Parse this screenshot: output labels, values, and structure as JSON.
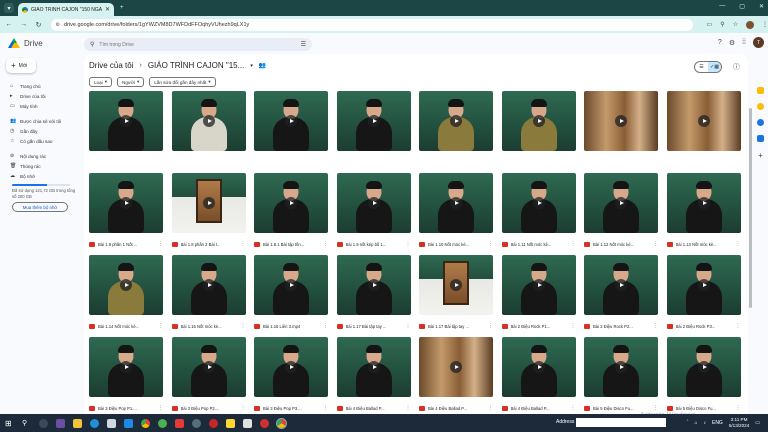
{
  "browser": {
    "tab_title": "GIÁO TRÌNH CAJON \"150 NGÀ",
    "url": "drive.google.com/drive/folders/1gYWZVM8D7WFDdFFOqhyVUhezh9qLX1y"
  },
  "app": {
    "name": "Drive"
  },
  "search": {
    "placeholder": "Tìm trong Drive"
  },
  "user": {
    "initial": "T"
  },
  "new_button": {
    "label": "Mới"
  },
  "sidebar": {
    "items": [
      {
        "label": "Trang chủ",
        "icon": "home-icon"
      },
      {
        "label": "Drive của tôi",
        "icon": "drive-icon"
      },
      {
        "label": "Máy tính",
        "icon": "computer-icon"
      },
      {
        "label": "Được chia sẻ với tôi",
        "icon": "people-icon"
      },
      {
        "label": "Gần đây",
        "icon": "clock-icon"
      },
      {
        "label": "Có gắn dấu sao",
        "icon": "star-icon"
      },
      {
        "label": "Nội dung rác",
        "icon": "spam-icon"
      },
      {
        "label": "Thùng rác",
        "icon": "trash-icon"
      },
      {
        "label": "Bộ nhớ",
        "icon": "cloud-icon"
      }
    ],
    "storage_text": "Đã sử dụng 121,72 GB trong tổng số 200 GB",
    "storage_fraction": 0.61,
    "buy_label": "Mua thêm bộ nhớ"
  },
  "breadcrumb": {
    "root": "Drive của tôi",
    "folder": "GIÁO TRÌNH CAJON \"15..."
  },
  "filters": [
    "Loại",
    "Người",
    "Lần sửa đổi gần đây nhất"
  ],
  "files": [
    {
      "name": "",
      "thumb": "person-dark"
    },
    {
      "name": "",
      "thumb": "person-light"
    },
    {
      "name": "",
      "thumb": "person-dark"
    },
    {
      "name": "",
      "thumb": "person-dark"
    },
    {
      "name": "",
      "thumb": "person-olive"
    },
    {
      "name": "",
      "thumb": "person-olive"
    },
    {
      "name": "",
      "thumb": "wood"
    },
    {
      "name": "",
      "thumb": "wood"
    },
    {
      "name": "Bài 1.8 phần 1 Nốt ...",
      "thumb": "person-dark"
    },
    {
      "name": "Bài 1.8 phần 2 Bài t...",
      "thumb": "cajon"
    },
    {
      "name": "Bài 1.8.1 Bài tập tốn...",
      "thumb": "person-dark"
    },
    {
      "name": "Bài 1.9 nốt kép bố 1...",
      "thumb": "person-dark"
    },
    {
      "name": "Bài 1.10 Nốt móc kè...",
      "thumb": "person-dark"
    },
    {
      "name": "Bài 1.11 Nốt móc kè...",
      "thumb": "person-dark"
    },
    {
      "name": "Bài 1.12 Nốt móc kè...",
      "thumb": "person-dark"
    },
    {
      "name": "Bài 1.13 Nốt móc kè...",
      "thumb": "person-dark"
    },
    {
      "name": "Bài 1.14 Nốt móc kè...",
      "thumb": "person-olive"
    },
    {
      "name": "Bài 1.15 Nốt móc kè...",
      "thumb": "person-dark"
    },
    {
      "name": "Bài 1.16 Liên 3.mp4",
      "thumb": "person-dark"
    },
    {
      "name": "Bài 1.17 Bài tập tay ...",
      "thumb": "person-dark"
    },
    {
      "name": "Bài 1.17 Bài tập tay ...",
      "thumb": "cajon"
    },
    {
      "name": "Bài 2 Điệu Rock P1...",
      "thumb": "person-dark"
    },
    {
      "name": "Bài 2 Điệu Rock P2...",
      "thumb": "person-dark"
    },
    {
      "name": "Bài 2 Điệu Rock P3...",
      "thumb": "person-dark"
    },
    {
      "name": "Bài 3 Điệu Pop P1....",
      "thumb": "person-dark"
    },
    {
      "name": "Bài 3 Điệu Pop P2....",
      "thumb": "person-dark"
    },
    {
      "name": "Bài 3 Điệu Pop P3....",
      "thumb": "person-dark"
    },
    {
      "name": "Bài 4 Điệu Ballad P...",
      "thumb": "person-dark"
    },
    {
      "name": "Bài 4 Điệu Ballad P...",
      "thumb": "wood"
    },
    {
      "name": "Bài 4 Điệu Ballad P...",
      "thumb": "person-dark"
    },
    {
      "name": "Bài 5 Điệu Disco Fu...",
      "thumb": "person-dark"
    },
    {
      "name": "Bài 5 Điệu Disco Fu...",
      "thumb": "person-dark"
    }
  ],
  "watermark": {
    "title": "Activate Windows",
    "subtitle": "Go to Settings to activate Windows."
  },
  "taskbar": {
    "address_label": "Address",
    "language": "ENG",
    "time": "3:11 PM",
    "date": "5/13/2024"
  }
}
